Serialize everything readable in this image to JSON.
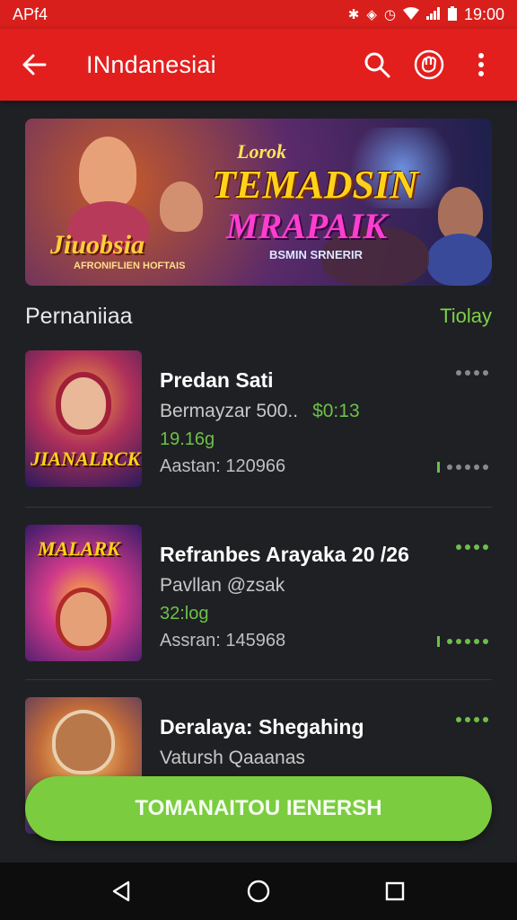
{
  "status_bar": {
    "left_text": "APf4",
    "time": "19:00",
    "icons": [
      "bluetooth-icon",
      "shield-icon",
      "alarm-icon",
      "wifi-icon",
      "signal-icon",
      "battery-icon"
    ]
  },
  "app_bar": {
    "title": "INndanesiai",
    "icons": [
      "back-arrow-icon",
      "search-icon",
      "fist-icon",
      "more-vert-icon"
    ],
    "accent": "#e21f1d"
  },
  "banner": {
    "line1": "Lorok",
    "line2": "TEMADSIN",
    "line3": "MRAPAIK",
    "line4": "BSMIN SRNERIR",
    "logo": "Jiuobsia",
    "logo_sub": "AFRONIFLIEN HOFTAIS"
  },
  "section": {
    "label": "Pernaniiaa",
    "link": "Tiolay"
  },
  "items": [
    {
      "thumb_title": "JIANALRCK",
      "name": "Predan Sati",
      "subtitle": "Bermayzar 500..",
      "price": "$0:13",
      "size": "19.16g",
      "meta": "Aastan: 120966"
    },
    {
      "thumb_title": "MALARK",
      "name": "Refranbes Arayaka 20 /26",
      "subtitle": "Pavllan @zsak",
      "price": "",
      "size": "32:log",
      "meta": "Assran: 145968"
    },
    {
      "thumb_title": "",
      "name": "Deralaya: Shegahing",
      "subtitle": "Vatursh Qaaanas",
      "price": "",
      "size": "",
      "meta": ""
    }
  ],
  "cta": {
    "label": "TOMANAITOU IENERSH",
    "color": "#7bcc3e"
  },
  "nav": {
    "icons": [
      "nav-back-icon",
      "nav-home-icon",
      "nav-recents-icon"
    ]
  }
}
